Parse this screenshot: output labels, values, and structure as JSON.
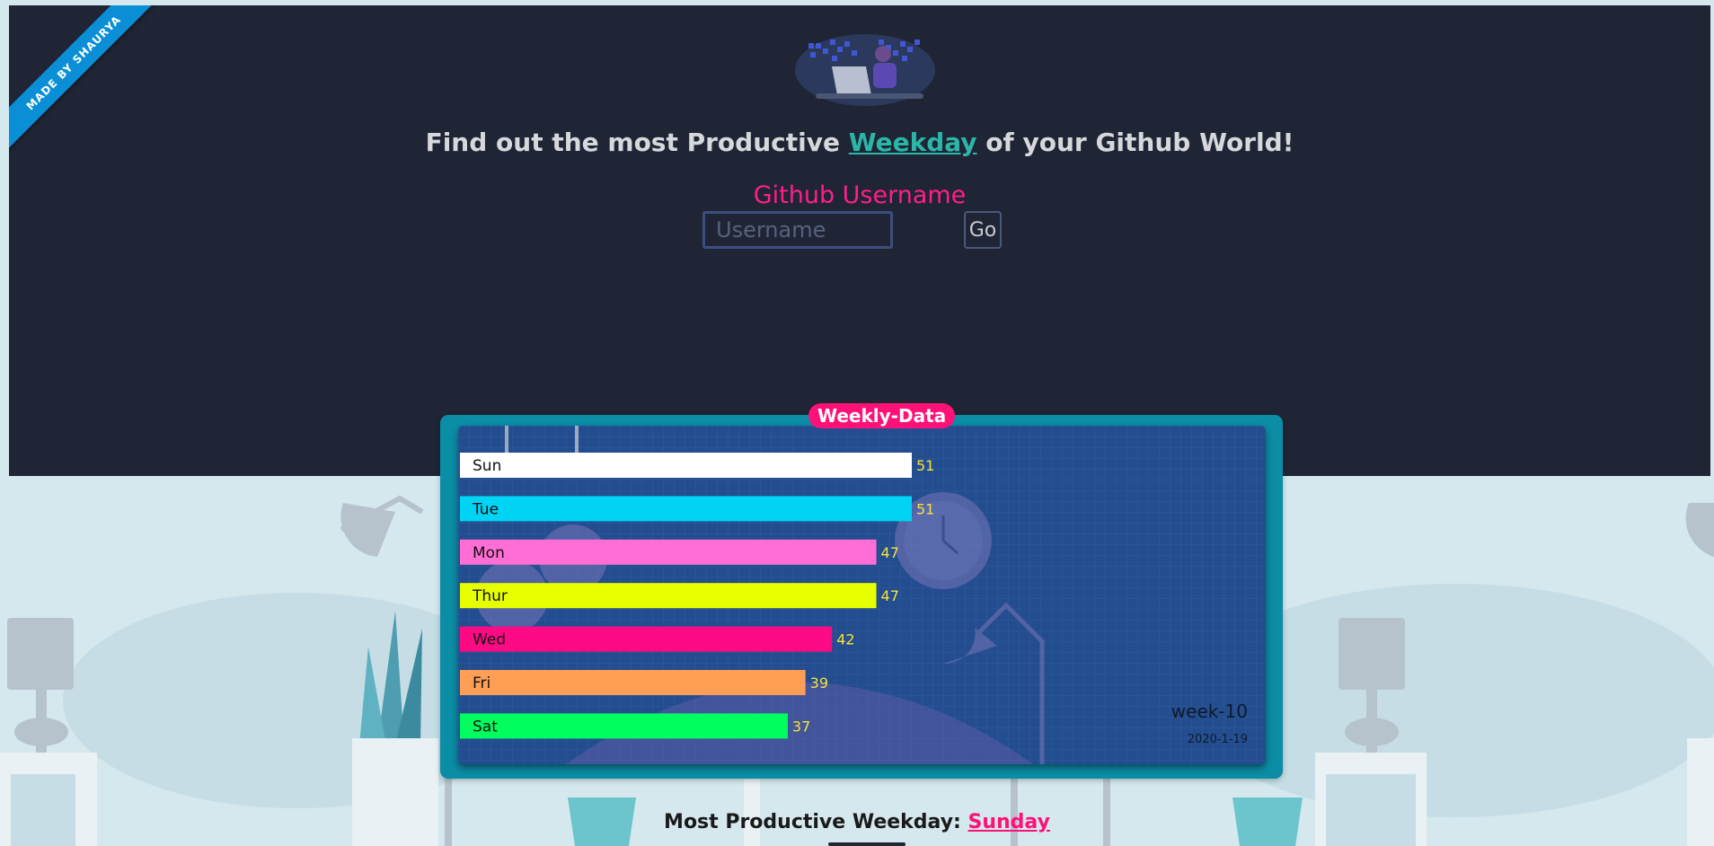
{
  "ribbon": {
    "text": "MADE BY SHAURYA"
  },
  "header": {
    "headline_before": "Find out the most Productive ",
    "headline_link": "Weekday",
    "headline_after": " of your Github World!"
  },
  "form": {
    "label": "Github Username",
    "username_placeholder": "Username",
    "go_label": "Go"
  },
  "card": {
    "title": "Weekly-Data",
    "week": "week-10",
    "date": "2020-1-19"
  },
  "colors": {
    "hero_bg": "#1f2535",
    "accent_pink": "#ff1178",
    "accent_teal": "#2bb6a7",
    "card_frame": "#0b8da6",
    "chart_bg": "#234d8f",
    "value_text": "#f6e33a"
  },
  "chart_data": {
    "type": "bar",
    "orientation": "horizontal",
    "categories": [
      "Sun",
      "Tue",
      "Mon",
      "Thur",
      "Wed",
      "Fri",
      "Sat"
    ],
    "values": [
      51,
      51,
      47,
      47,
      42,
      39,
      37
    ],
    "bar_colors": [
      "#ffffff",
      "#00d4f5",
      "#ff6ed5",
      "#e8ff00",
      "#ff0a85",
      "#ff9f55",
      "#00ff5e"
    ],
    "title": "Weekly-Data",
    "xlim": [
      0,
      51
    ]
  },
  "result": {
    "label": "Most Productive Weekday: ",
    "value": "Sunday"
  }
}
